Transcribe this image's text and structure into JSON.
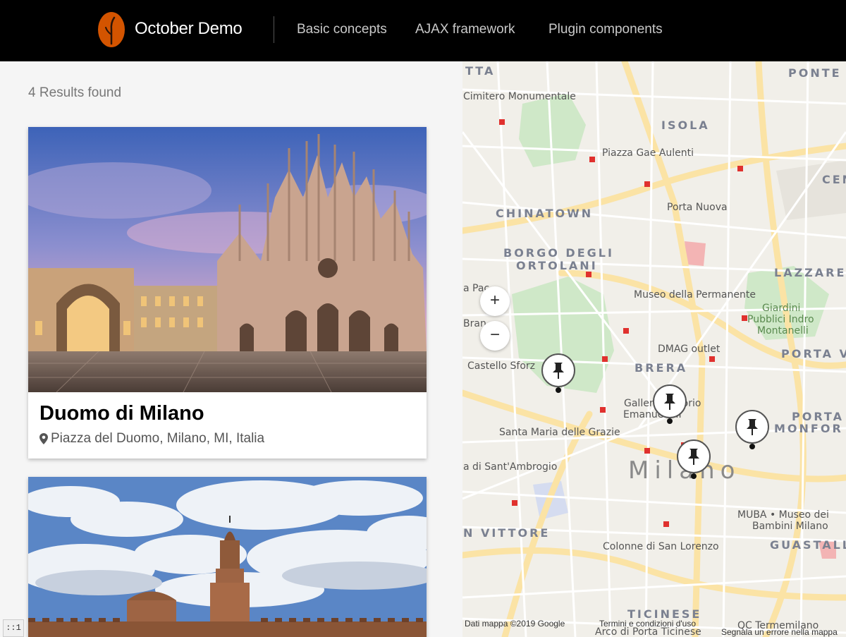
{
  "header": {
    "brand": "October Demo",
    "nav": [
      "Basic concepts",
      "AJAX framework",
      "Plugin components"
    ],
    "colors": {
      "background": "#000000",
      "logo": "#d35400"
    }
  },
  "results": {
    "text": "4 Results found"
  },
  "cards": [
    {
      "title": "Duomo di Milano",
      "address": "Piazza del Duomo, Milano, MI, Italia",
      "icon": "map-marker-icon"
    },
    {
      "title": "",
      "address": ""
    }
  ],
  "map": {
    "zoom_in": "+",
    "zoom_out": "−",
    "labels": {
      "tta": "TTA",
      "ponte": "PONTE",
      "cimitero": "Cimitero Monumentale",
      "isola": "ISOLA",
      "gae": "Piazza Gae Aulenti",
      "cen": "CEN",
      "chinatown": "CHINATOWN",
      "porta_nuova": "Porta Nuova",
      "borgo1": "BORGO DEGLI",
      "borgo2": "ORTOLANI",
      "lazzaret": "LAZZARET",
      "pac": "a Pac",
      "museo_perm": "Museo della Permanente",
      "giardini1": "Giardini",
      "giardini2": "Pubblici Indro",
      "giardini3": "Montanelli",
      "bran": "Bran",
      "dmag": "DMAG outlet",
      "porta_v": "PORTA V",
      "castello": "Castello Sforz",
      "brera": "BRERA",
      "galleria1": "Galleria Vittorio",
      "galleria2": "Emanuele II",
      "porta_m1": "PORTA",
      "porta_m2": "MONFOR",
      "santa_maria": "Santa Maria delle Grazie",
      "ambrogio": "a di Sant'Ambrogio",
      "milano": "Milano",
      "vittore": "N VITTORE",
      "muba1": "MUBA • Museo dei",
      "muba2": "Bambini Milano",
      "guastall": "GUASTALL",
      "colonne": "Colonne di San Lorenzo",
      "ticinese": "TICINESE",
      "termemilano": "QC Termemilano",
      "arco": "Arco di Porta Ticinese"
    },
    "footer": {
      "data": "Dati mappa ©2019 Google",
      "terms": "Termini e condizioni d'uso",
      "report": "Segnala un errore nella mappa"
    },
    "markers": [
      {
        "name": "marker-1",
        "icon": "pushpin-icon"
      },
      {
        "name": "marker-2",
        "icon": "pushpin-icon"
      },
      {
        "name": "marker-3",
        "icon": "pushpin-icon"
      },
      {
        "name": "marker-4",
        "icon": "pushpin-icon"
      }
    ]
  },
  "corner": {
    "text": "::1"
  }
}
